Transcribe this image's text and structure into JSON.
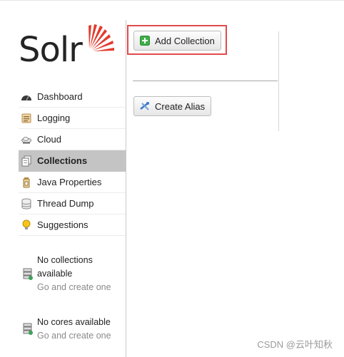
{
  "logo": {
    "text": "Solr"
  },
  "sidebar": {
    "items": [
      {
        "label": "Dashboard",
        "icon": "dashboard-icon",
        "active": false
      },
      {
        "label": "Logging",
        "icon": "logging-icon",
        "active": false
      },
      {
        "label": "Cloud",
        "icon": "cloud-icon",
        "active": false
      },
      {
        "label": "Collections",
        "icon": "collections-icon",
        "active": true
      },
      {
        "label": "Java Properties",
        "icon": "java-icon",
        "active": false
      },
      {
        "label": "Thread Dump",
        "icon": "thread-dump-icon",
        "active": false
      },
      {
        "label": "Suggestions",
        "icon": "lightbulb-icon",
        "active": false
      }
    ],
    "collections_status": {
      "main": "No collections available",
      "sub": "Go and create one"
    },
    "cores_status": {
      "main": "No cores available",
      "sub": "Go and create one"
    }
  },
  "actions": {
    "add_collection": "Add Collection",
    "create_alias": "Create Alias"
  },
  "colors": {
    "highlight": "#e04b4b",
    "active_bg": "#c4c4c4",
    "logo_accent": "#e23b2e"
  },
  "watermark": "CSDN @云叶知秋"
}
